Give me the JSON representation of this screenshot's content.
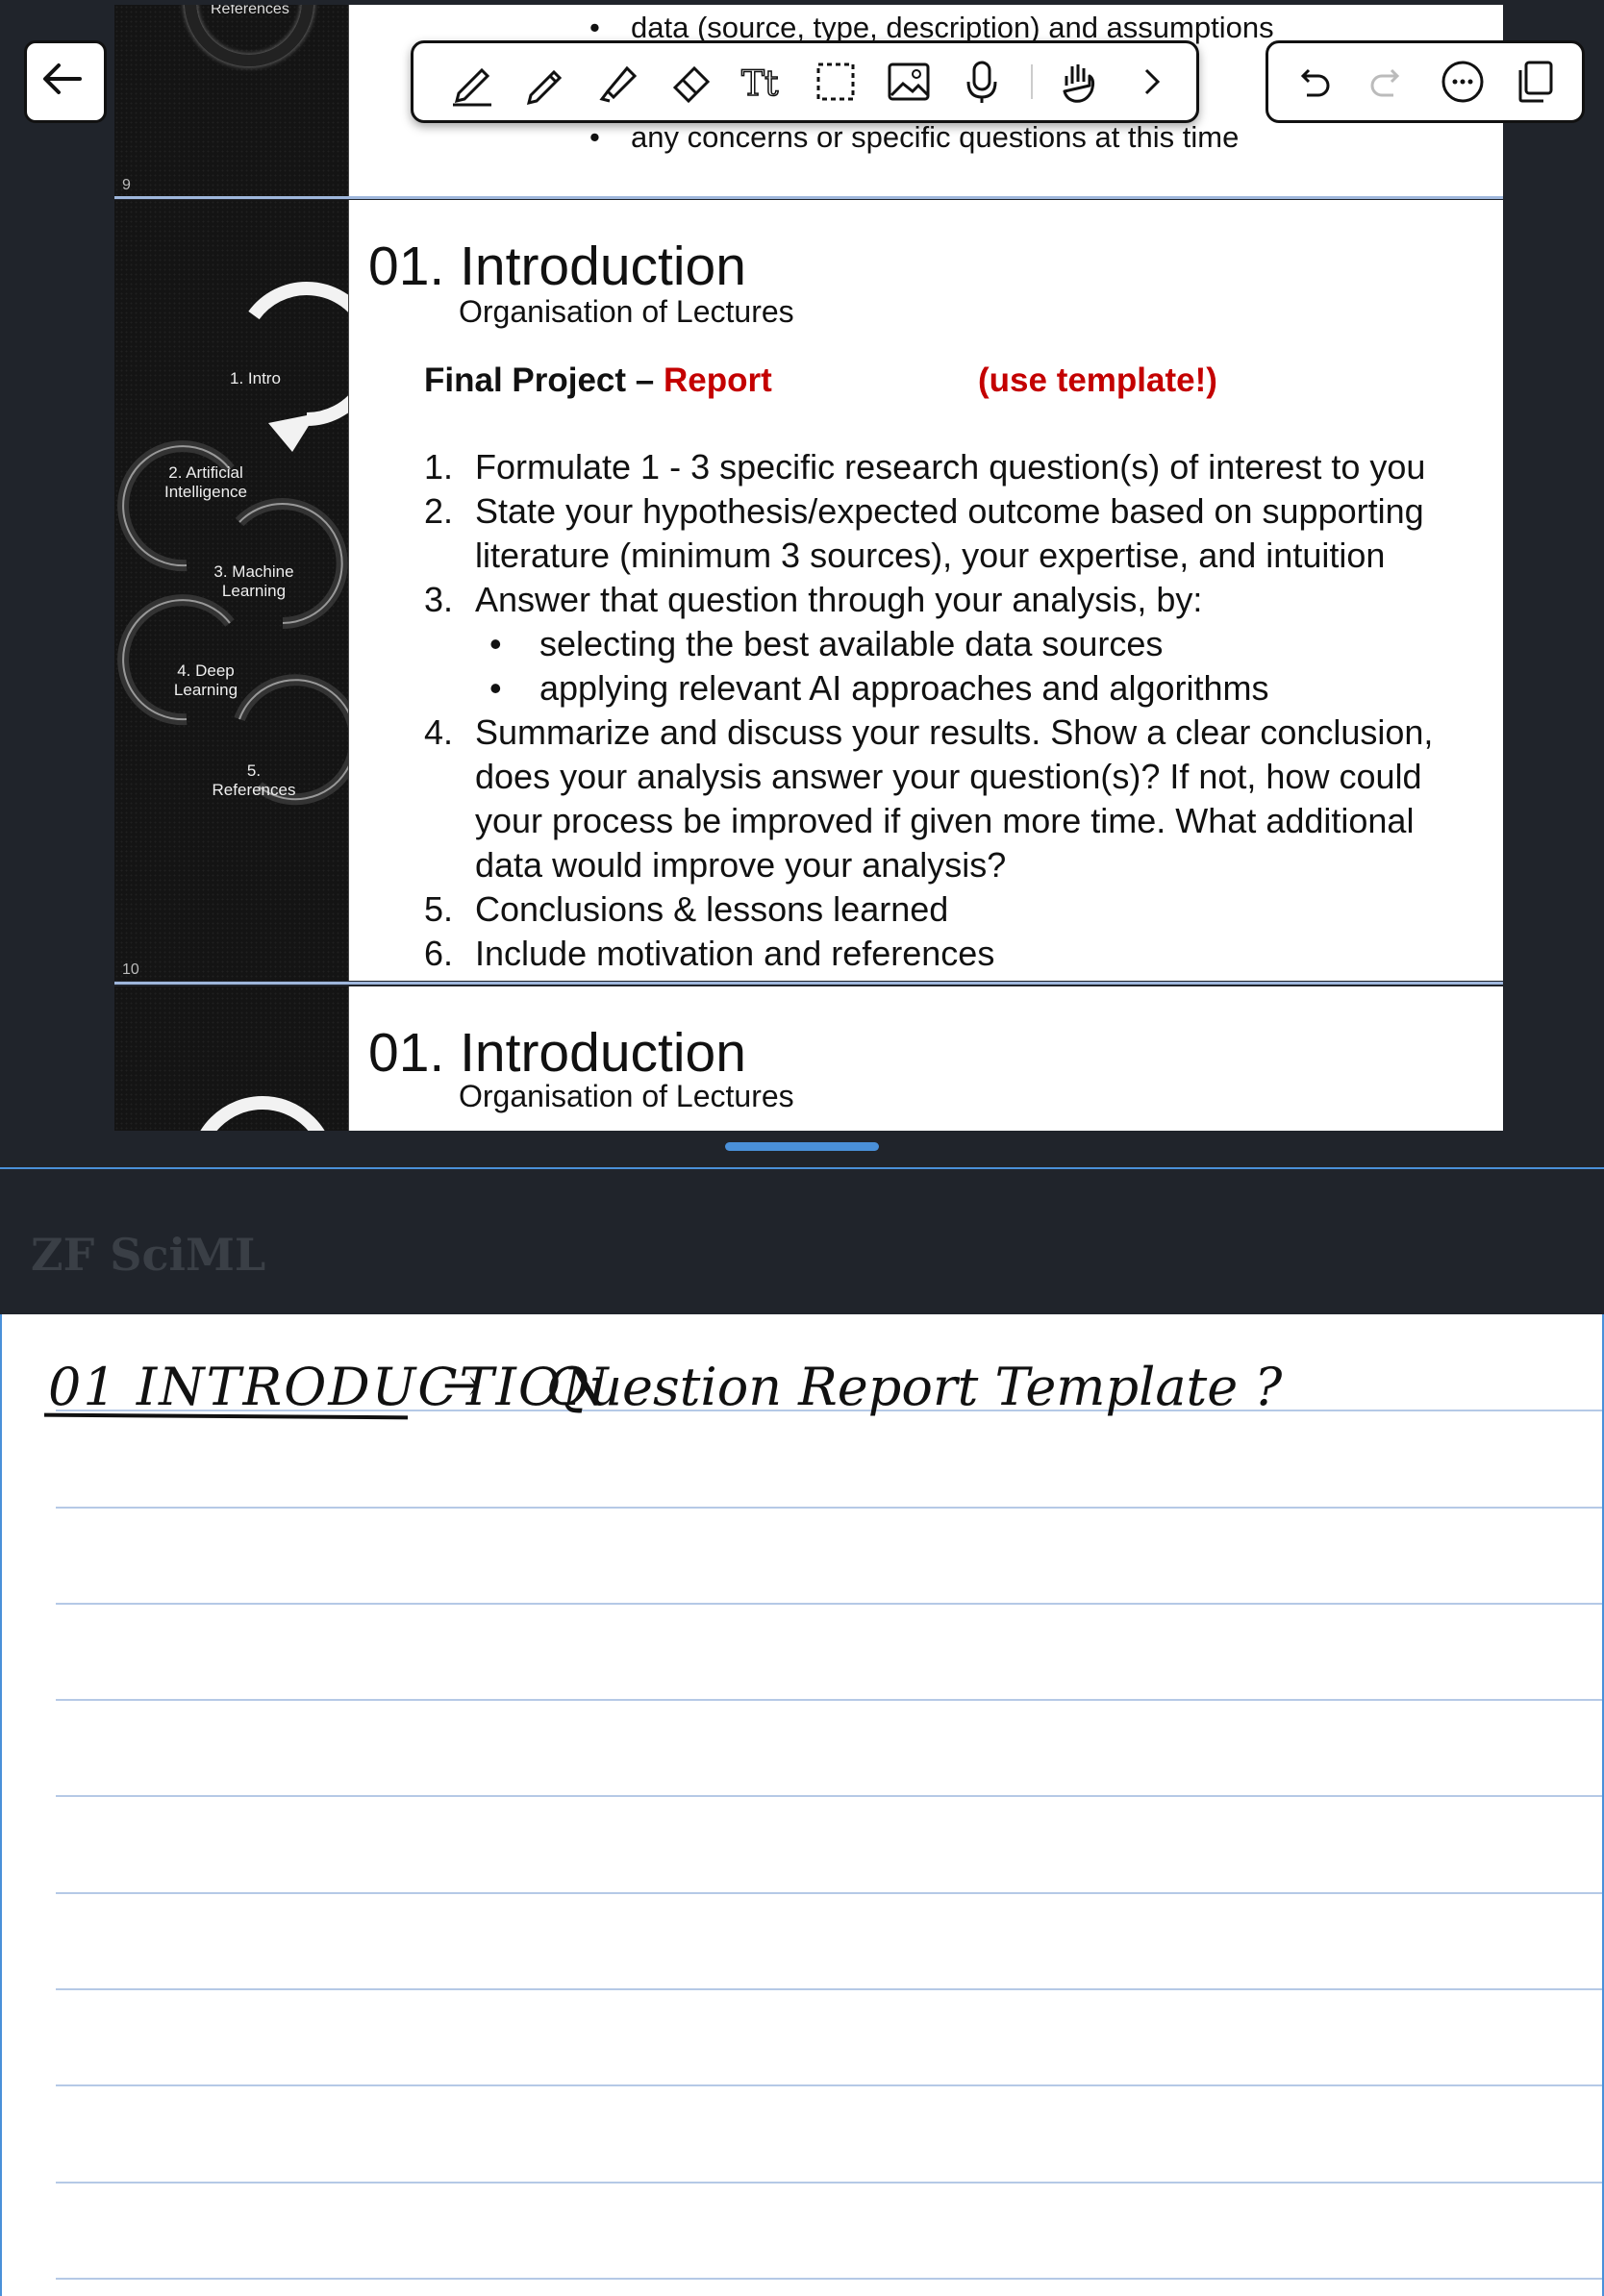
{
  "slide_top": {
    "bullet_1": "data (source, type, description) and assumptions",
    "bullet_2": "any concerns or specific questions at this time",
    "thumb_label": "References",
    "page_number": "9"
  },
  "slide_main": {
    "page_number": "10",
    "title": "01. Introduction",
    "subtitle": "Organisation of Lectures",
    "project_prefix": "Final Project – ",
    "project_highlight": "Report",
    "project_note": "(use template!)",
    "items": [
      {
        "num": "1.",
        "text": "Formulate 1 - 3 specific research question(s) of interest to you"
      },
      {
        "num": "2.",
        "text": "State your hypothesis/expected outcome based on supporting literature (minimum 3 sources), your expertise, and intuition"
      },
      {
        "num": "3.",
        "text": "Answer that question through your analysis, by:"
      },
      {
        "num": "4.",
        "text": "Summarize and discuss your results. Show a clear conclusion, does your analysis answer your question(s)? If not, how could your process be improved if given more time. What additional data would improve your analysis?"
      },
      {
        "num": "5.",
        "text": "Conclusions & lessons learned"
      },
      {
        "num": "6.",
        "text": "Include motivation and references"
      }
    ],
    "sub_bullets": [
      "selecting the best available data sources",
      "applying relevant AI approaches and algorithms"
    ],
    "thumb_steps": [
      "1. Intro",
      "2. Artificial Intelligence",
      "3. Machine Learning",
      "4. Deep Learning",
      "5. References"
    ]
  },
  "slide_next": {
    "title": "01. Introduction",
    "subtitle": "Organisation of Lectures"
  },
  "toolbar": {
    "tools": [
      "pen-icon",
      "pencil-icon",
      "highlighter-icon",
      "eraser-icon",
      "text-icon",
      "lasso-icon",
      "image-icon",
      "microphone-icon",
      "hand-icon",
      "chevron-right-icon"
    ],
    "actions": [
      "undo-icon",
      "redo-icon",
      "more-icon",
      "pages-icon"
    ]
  },
  "notes": {
    "watermark": "ZF SciML",
    "handwriting_title": "01 INTRODUCTION",
    "handwriting_arrow": "→",
    "handwriting_rest": "Question  Report Template ?"
  },
  "colors": {
    "accent": "#4a90d9",
    "red": "#c40000",
    "background": "#20242b"
  }
}
